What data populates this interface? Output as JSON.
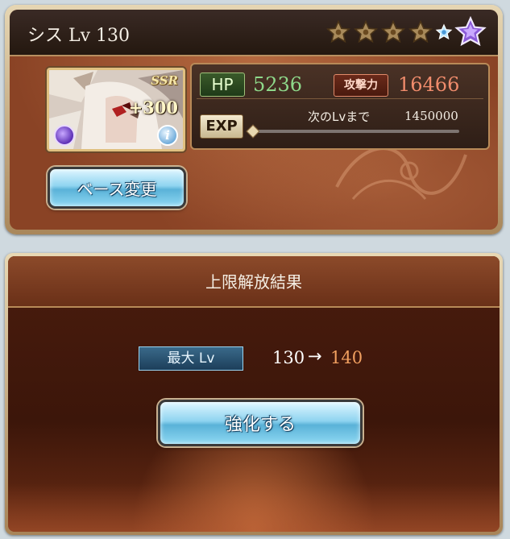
{
  "character": {
    "name_label": "シス  Lv 130",
    "rarity_badge": "SSR",
    "plus_bonus": "+300",
    "uncap_stars": {
      "filled": 4,
      "blue": 1,
      "purple": 1
    }
  },
  "stats": {
    "hp_label": "HP",
    "hp_value": "5236",
    "atk_label": "攻撃力",
    "atk_value": "16466",
    "exp_label": "EXP",
    "next_lv_label": "次のLvまで",
    "exp_to_next": "1450000",
    "exp_progress": 0
  },
  "buttons": {
    "base_change": "ベース変更",
    "enhance": "強化する"
  },
  "result": {
    "title": "上限解放結果",
    "max_lv_label": "最大 Lv",
    "lv_from": "130",
    "arrow": "→",
    "lv_to": "140"
  },
  "colors": {
    "hp_value": "#8ed88a",
    "atk_value": "#f08c6c",
    "new_level": "#f2a060"
  }
}
